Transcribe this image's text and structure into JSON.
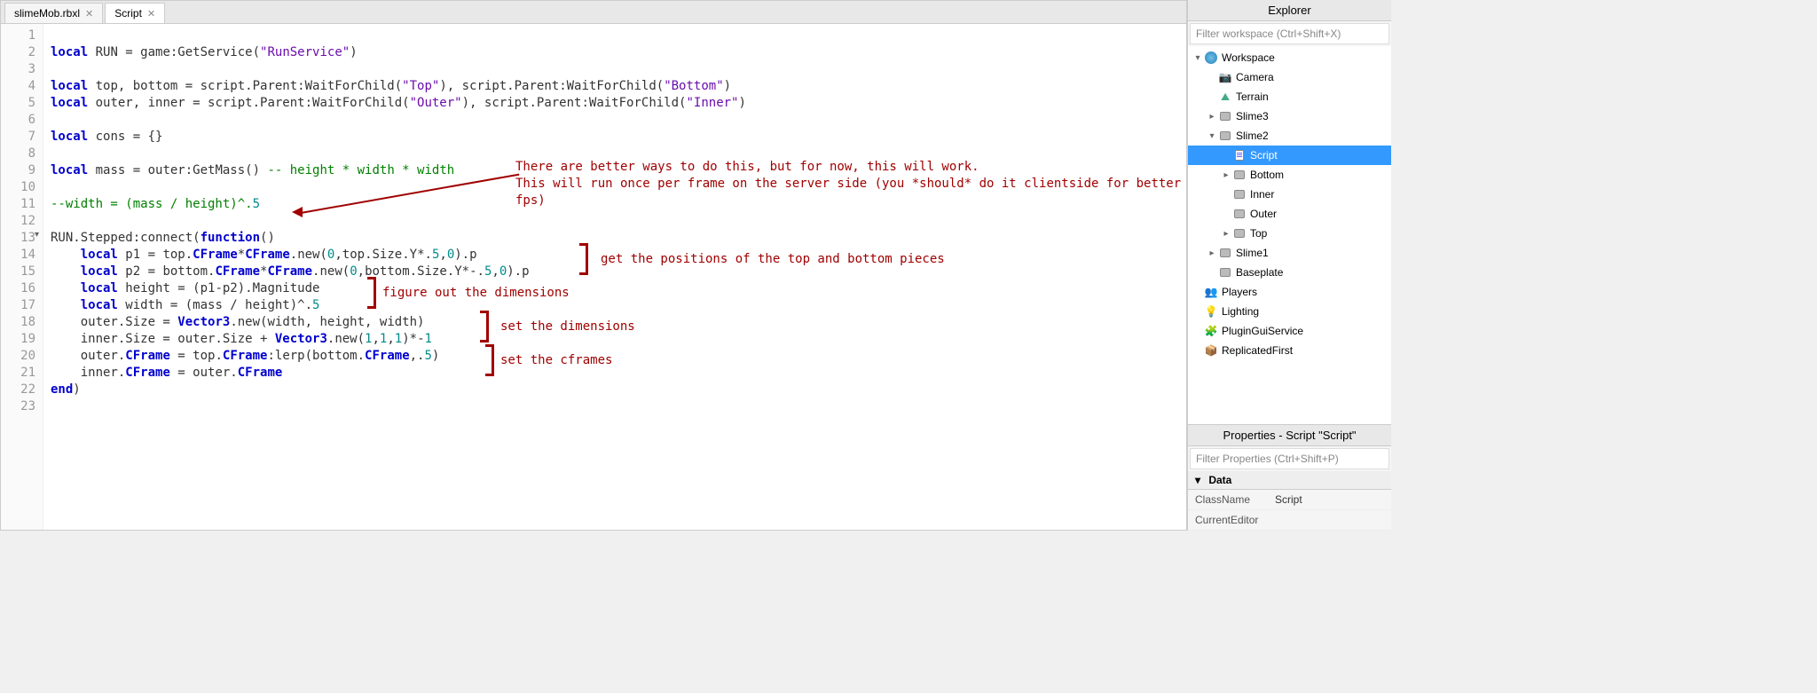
{
  "tabs": [
    {
      "label": "slimeMob.rbxl",
      "active": false
    },
    {
      "label": "Script",
      "active": true
    }
  ],
  "code_lines": [
    "",
    "local RUN = game:GetService(\"RunService\")",
    "",
    "local top, bottom = script.Parent:WaitForChild(\"Top\"), script.Parent:WaitForChild(\"Bottom\")",
    "local outer, inner = script.Parent:WaitForChild(\"Outer\"), script.Parent:WaitForChild(\"Inner\")",
    "",
    "local cons = {}",
    "",
    "local mass = outer:GetMass() -- height * width * width",
    "",
    "--width = (mass / height)^.5",
    "",
    "RUN.Stepped:connect(function()",
    "    local p1 = top.CFrame*CFrame.new(0,top.Size.Y*.5,0).p",
    "    local p2 = bottom.CFrame*CFrame.new(0,bottom.Size.Y*-.5,0).p",
    "    local height = (p1-p2).Magnitude",
    "    local width = (mass / height)^.5",
    "    outer.Size = Vector3.new(width, height, width)",
    "    inner.Size = outer.Size + Vector3.new(1,1,1)*-1",
    "    outer.CFrame = top.CFrame:lerp(bottom.CFrame,.5)",
    "    inner.CFrame = outer.CFrame",
    "end)",
    ""
  ],
  "annotations": {
    "a1": "There are better ways to do this, but for now, this will work.\nThis will run once per frame on the server side (you *should* do it clientside for better fps)",
    "a2": "get the positions of the top and bottom pieces",
    "a3": "figure out the dimensions",
    "a4": "set the dimensions",
    "a5": "set the cframes"
  },
  "explorer": {
    "title": "Explorer",
    "filter_placeholder": "Filter workspace (Ctrl+Shift+X)",
    "tree": [
      {
        "label": "Workspace",
        "icon": "globe",
        "indent": 0,
        "expand": "open"
      },
      {
        "label": "Camera",
        "icon": "camera",
        "indent": 1,
        "expand": "none"
      },
      {
        "label": "Terrain",
        "icon": "terrain",
        "indent": 1,
        "expand": "none"
      },
      {
        "label": "Slime3",
        "icon": "part",
        "indent": 1,
        "expand": "closed"
      },
      {
        "label": "Slime2",
        "icon": "part",
        "indent": 1,
        "expand": "open"
      },
      {
        "label": "Script",
        "icon": "script",
        "indent": 2,
        "expand": "none",
        "selected": true
      },
      {
        "label": "Bottom",
        "icon": "part",
        "indent": 2,
        "expand": "closed"
      },
      {
        "label": "Inner",
        "icon": "part",
        "indent": 2,
        "expand": "none"
      },
      {
        "label": "Outer",
        "icon": "part",
        "indent": 2,
        "expand": "none"
      },
      {
        "label": "Top",
        "icon": "part",
        "indent": 2,
        "expand": "closed"
      },
      {
        "label": "Slime1",
        "icon": "part",
        "indent": 1,
        "expand": "closed"
      },
      {
        "label": "Baseplate",
        "icon": "part",
        "indent": 1,
        "expand": "none"
      },
      {
        "label": "Players",
        "icon": "players",
        "indent": 0,
        "expand": "none"
      },
      {
        "label": "Lighting",
        "icon": "light",
        "indent": 0,
        "expand": "none"
      },
      {
        "label": "PluginGuiService",
        "icon": "plugin",
        "indent": 0,
        "expand": "none"
      },
      {
        "label": "ReplicatedFirst",
        "icon": "repl",
        "indent": 0,
        "expand": "none"
      }
    ]
  },
  "properties": {
    "title": "Properties - Script \"Script\"",
    "filter_placeholder": "Filter Properties (Ctrl+Shift+P)",
    "section": "Data",
    "rows": [
      {
        "k": "ClassName",
        "v": "Script"
      },
      {
        "k": "CurrentEditor",
        "v": ""
      }
    ]
  }
}
